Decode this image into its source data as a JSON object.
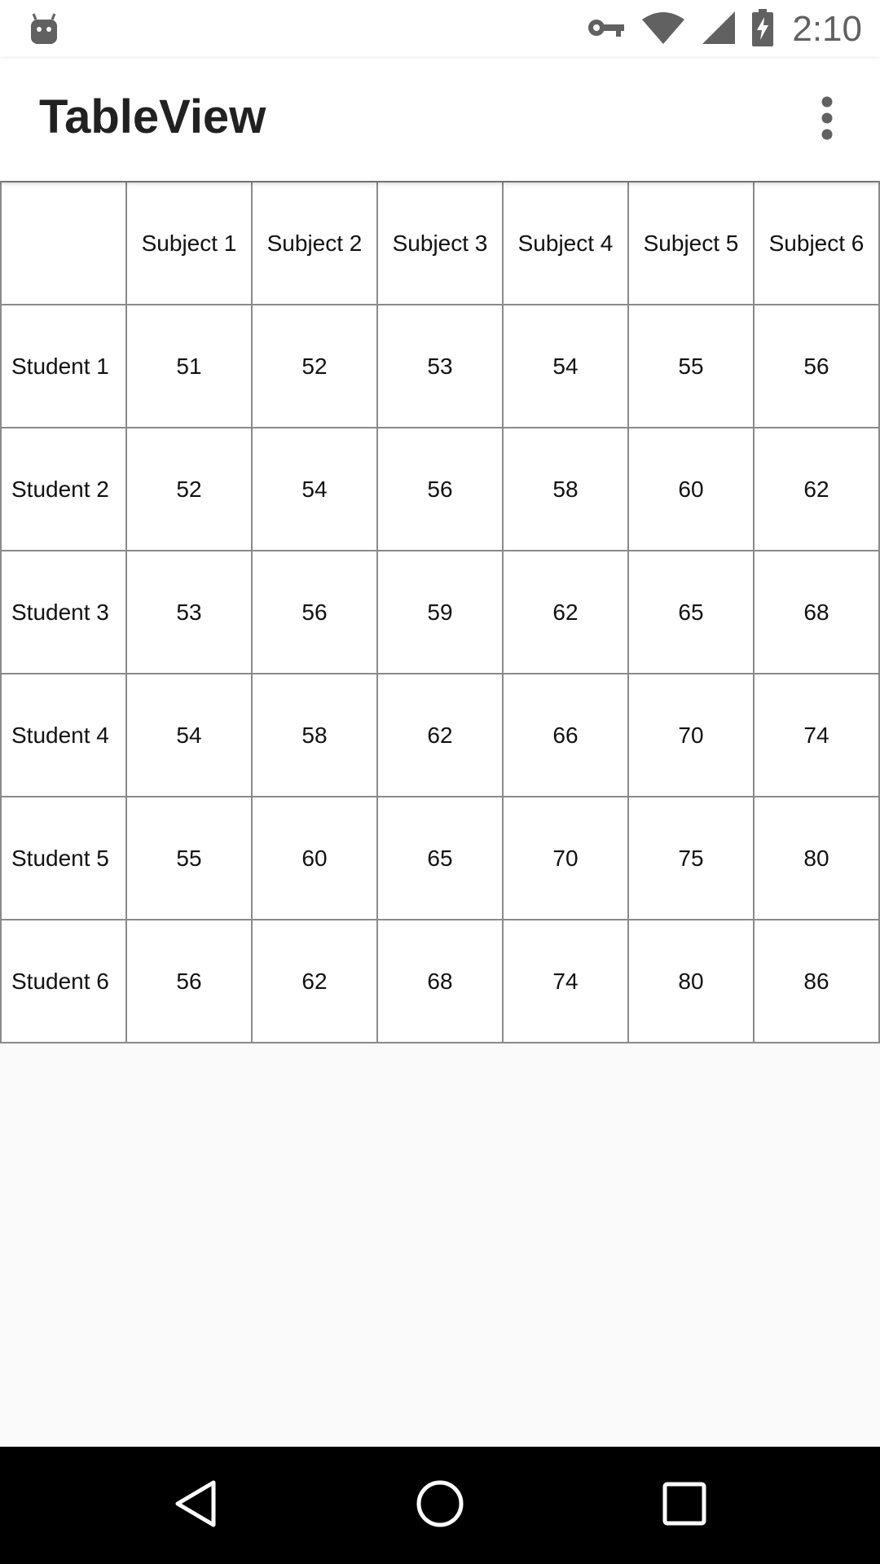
{
  "status_bar": {
    "time": "2:10",
    "icons": [
      "android-debug-icon",
      "vpn-key-icon",
      "wifi-icon",
      "cell-signal-icon",
      "battery-charging-icon"
    ]
  },
  "app_bar": {
    "title": "TableView",
    "menu_icon": "more-vert-icon"
  },
  "table": {
    "corner": "",
    "columns": [
      "Subject 1",
      "Subject 2",
      "Subject 3",
      "Subject 4",
      "Subject 5",
      "Subject 6"
    ],
    "rows": [
      {
        "label": "Student 1",
        "values": [
          "51",
          "52",
          "53",
          "54",
          "55",
          "56"
        ]
      },
      {
        "label": "Student 2",
        "values": [
          "52",
          "54",
          "56",
          "58",
          "60",
          "62"
        ]
      },
      {
        "label": "Student 3",
        "values": [
          "53",
          "56",
          "59",
          "62",
          "65",
          "68"
        ]
      },
      {
        "label": "Student 4",
        "values": [
          "54",
          "58",
          "62",
          "66",
          "70",
          "74"
        ]
      },
      {
        "label": "Student 5",
        "values": [
          "55",
          "60",
          "65",
          "70",
          "75",
          "80"
        ]
      },
      {
        "label": "Student 6",
        "values": [
          "56",
          "62",
          "68",
          "74",
          "80",
          "86"
        ]
      }
    ]
  },
  "nav_bar": {
    "icons": [
      "back-icon",
      "home-icon",
      "recents-icon"
    ]
  },
  "colors": {
    "status_icon": "#616161",
    "grid_line": "#8a8a8a",
    "background": "#fafafa",
    "nav_bar": "#000000"
  }
}
